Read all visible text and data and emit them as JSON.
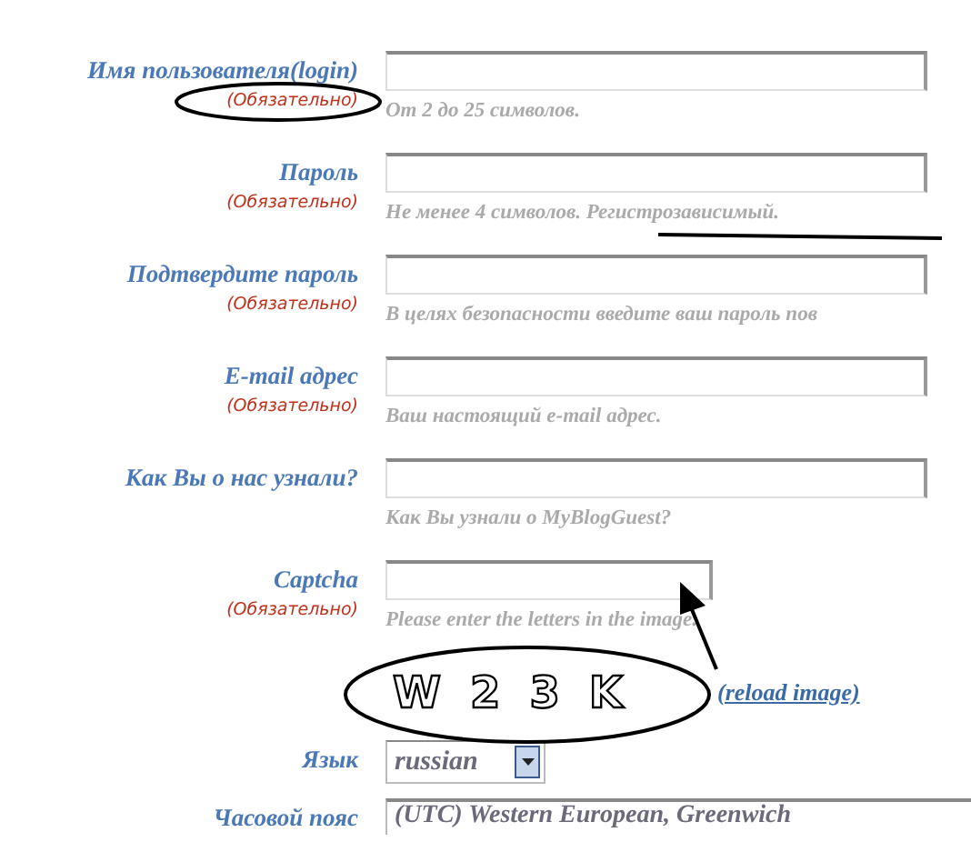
{
  "fields": [
    {
      "kind": "text",
      "label": "Имя пользователя(login)",
      "note": "(Обязательно)",
      "hint": "От 2 до 25 символов."
    },
    {
      "kind": "text",
      "label": "Пароль",
      "note": "(Обязательно)",
      "hint": "Не менее 4 символов. Регистрозависимый."
    },
    {
      "kind": "text",
      "label": "Подтвердите пароль",
      "note": "(Обязательно)",
      "hint": "В целях безопасности введите ваш пароль пов"
    },
    {
      "kind": "text",
      "label": "E-mail адрес",
      "note": "(Обязательно)",
      "hint": "Ваш настоящий e-mail адрес."
    },
    {
      "kind": "text",
      "label": "Как Вы о нас узнали?",
      "hint": "Как Вы узнали о MyBlogGuest?"
    },
    {
      "kind": "captcha",
      "label": "Captcha",
      "note": "(Обязательно)",
      "hint": "Please enter the letters in the image.",
      "characters": [
        "W",
        "2",
        "3",
        "K"
      ],
      "link": "(reload image)"
    },
    {
      "kind": "select",
      "label": "Язык",
      "value": "russian"
    },
    {
      "kind": "wide-select",
      "label": "Часовой пояс",
      "value": "(UTC) Western European, Greenwich"
    }
  ]
}
